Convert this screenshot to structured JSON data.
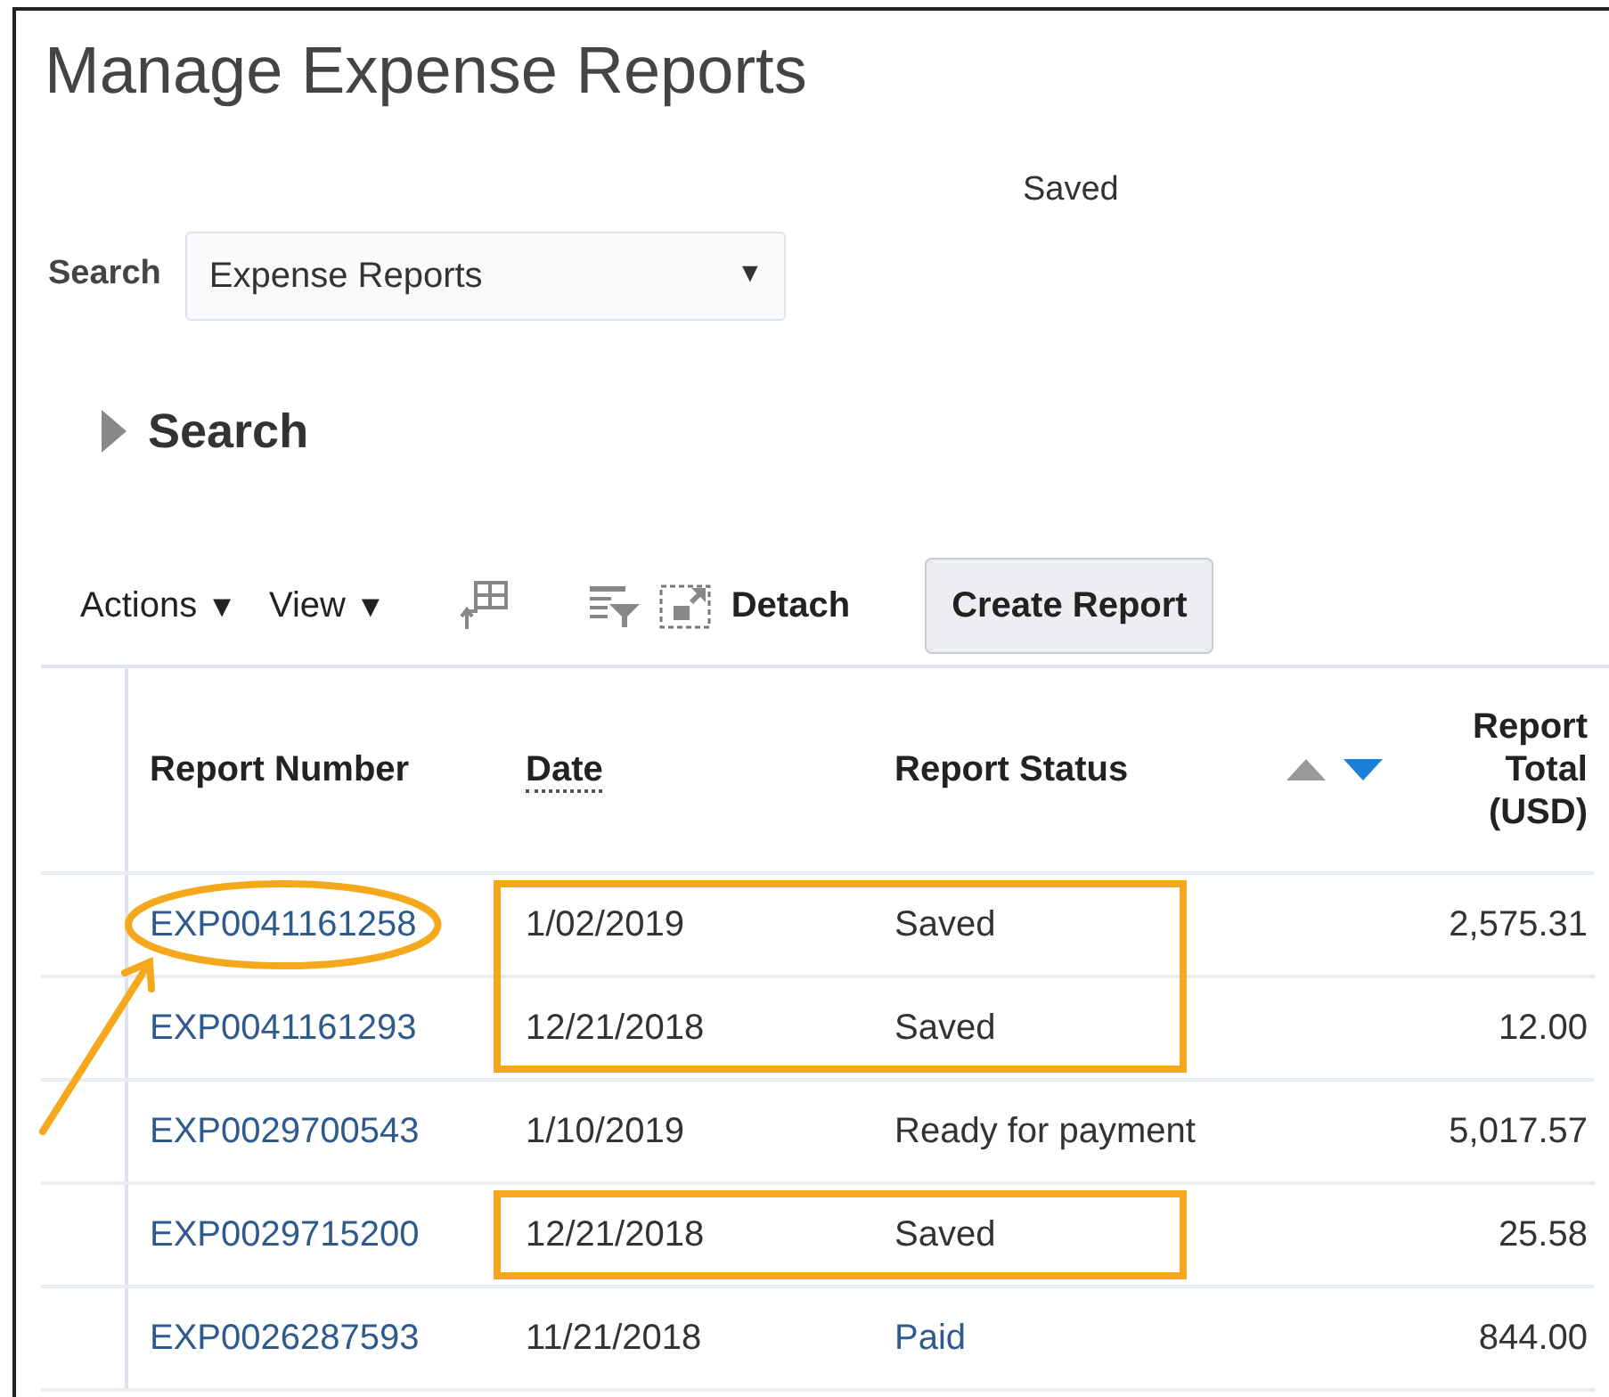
{
  "page": {
    "title": "Manage Expense Reports",
    "saved_label": "Saved"
  },
  "search_bar": {
    "label": "Search",
    "value": "Expense Reports",
    "caret": "▼"
  },
  "search_section": {
    "title": "Search",
    "expanded": false
  },
  "toolbar": {
    "menus": [
      {
        "label": "Actions",
        "caret": "▼"
      },
      {
        "label": "View",
        "caret": "▼"
      }
    ],
    "detach": "Detach",
    "create_button": "Create Report"
  },
  "table": {
    "columns": [
      "Report Number",
      "Date",
      "Report Status",
      "Report Total (USD)"
    ],
    "sort": {
      "ascending": false,
      "descending": true
    },
    "rows": [
      {
        "number": "EXP0041161258",
        "date": "1/02/2019",
        "status": "Saved",
        "status_link": false,
        "total": "2,575.31",
        "circled": true,
        "boxed": true
      },
      {
        "number": "EXP0041161293",
        "date": "12/21/2018",
        "status": "Saved",
        "status_link": false,
        "total": "12.00",
        "circled": false,
        "boxed": true
      },
      {
        "number": "EXP0029700543",
        "date": "1/10/2019",
        "status": "Ready for payment",
        "status_link": false,
        "total": "5,017.57",
        "circled": false,
        "boxed": false
      },
      {
        "number": "EXP0029715200",
        "date": "12/21/2018",
        "status": "Saved",
        "status_link": false,
        "total": "25.58",
        "circled": false,
        "boxed": true
      },
      {
        "number": "EXP0026287593",
        "date": "11/21/2018",
        "status": "Paid",
        "status_link": true,
        "total": "844.00",
        "circled": false,
        "boxed": false
      }
    ]
  }
}
